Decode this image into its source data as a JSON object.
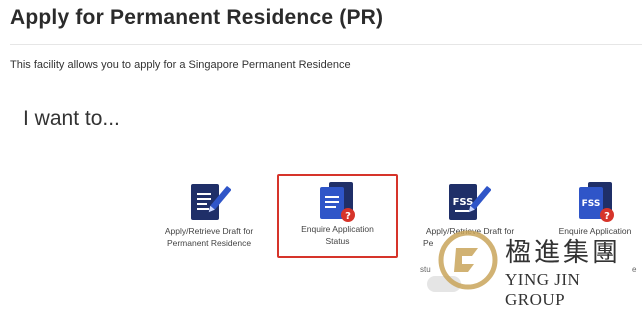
{
  "page": {
    "title": "Apply for Permanent Residence (PR)",
    "description": "This facility allows you to apply for a Singapore Permanent Residence",
    "section_heading": "I want to..."
  },
  "cards": [
    {
      "label_line1": "Apply/Retrieve Draft for",
      "label_line2": "Permanent Residence",
      "icon": "document-pen-icon"
    },
    {
      "label_line1": "Enquire Application",
      "label_line2": "Status",
      "icon": "document-question-icon"
    },
    {
      "label_line1": "Apply/Retrieve Draft for",
      "label_line2": "Pe",
      "icon": "fss-document-pen-icon",
      "badge": "FSS"
    },
    {
      "label_line1": "Enquire Application",
      "label_line2": "",
      "icon": "fss-document-question-icon",
      "badge": "FSS"
    }
  ],
  "partial_text": {
    "st": "stu",
    "e": "e"
  },
  "watermark": {
    "chinese": "楹進集團",
    "english": "YING JIN GROUP"
  },
  "colors": {
    "icon_navy": "#1f2f68",
    "icon_blue": "#2f55c8",
    "question_red": "#d6342a",
    "highlight_red": "#d6342a",
    "logo_gold": "#c9a55a"
  }
}
